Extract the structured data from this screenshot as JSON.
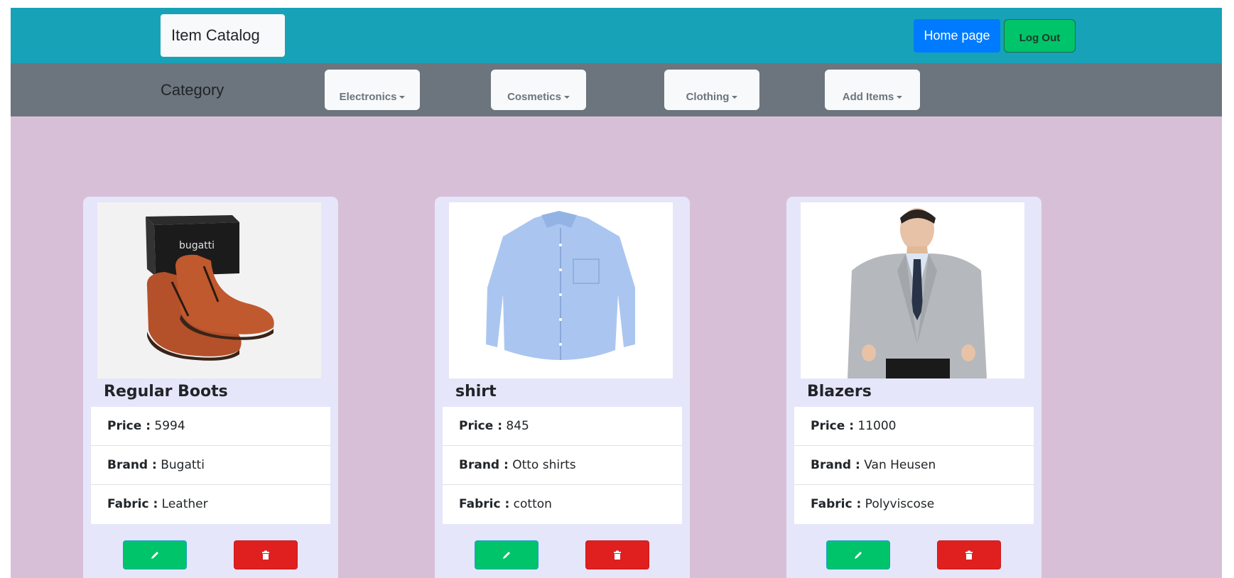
{
  "navbar": {
    "brand": "Item Catalog",
    "home_label": "Home page",
    "logout_label": "Log Out",
    "color": "#17a2b8"
  },
  "category_bar": {
    "label": "Category",
    "menus": [
      "Electronics",
      "Cosmetics",
      "Clothing",
      "Add Items"
    ]
  },
  "labels": {
    "price": "Price :",
    "brand": "Brand :",
    "fabric": "Fabric :"
  },
  "items": [
    {
      "name": "Regular Boots",
      "price": "5994",
      "brand": "Bugatti",
      "fabric": "Leather",
      "image": "brown leather boots with bugatti box"
    },
    {
      "name": "shirt",
      "price": "845",
      "brand": "Otto shirts",
      "fabric": "cotton",
      "image": "light blue button-down shirt"
    },
    {
      "name": "Blazers",
      "price": "11000",
      "brand": "Van Heusen",
      "fabric": "Polyviscose",
      "image": "man wearing grey blazer"
    }
  ],
  "actions": {
    "edit_icon": "pencil-icon",
    "delete_icon": "trash-icon",
    "edit_color": "#00c46a",
    "delete_color": "#e0201f"
  },
  "boot_logo_text": "bugatti"
}
